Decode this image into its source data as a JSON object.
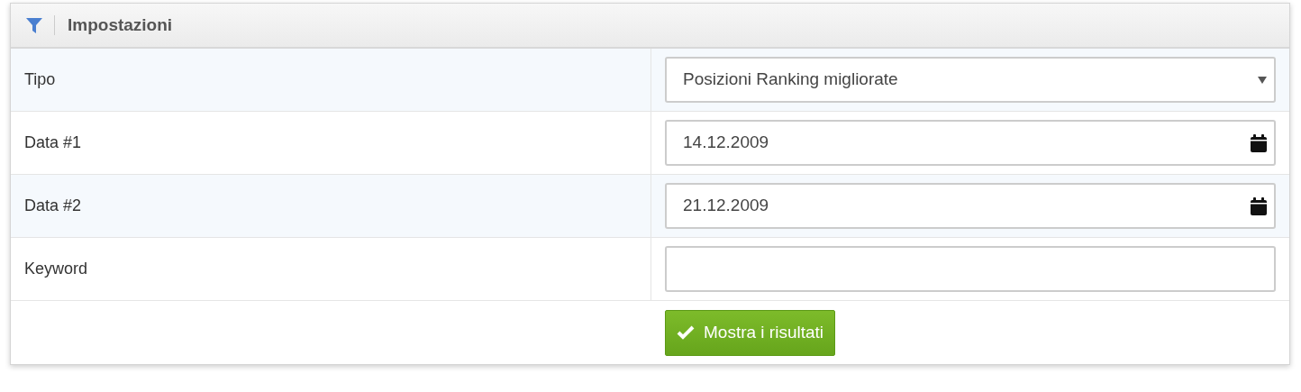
{
  "panel": {
    "title": "Impostazioni"
  },
  "rows": [
    {
      "label": "Tipo",
      "kind": "select",
      "value": "Posizioni Ranking migliorate"
    },
    {
      "label": "Data #1",
      "kind": "date",
      "value": "14.12.2009"
    },
    {
      "label": "Data #2",
      "kind": "date",
      "value": "21.12.2009"
    },
    {
      "label": "Keyword",
      "kind": "text",
      "value": ""
    }
  ],
  "submit_button": {
    "label": "Mostra i risultati"
  }
}
